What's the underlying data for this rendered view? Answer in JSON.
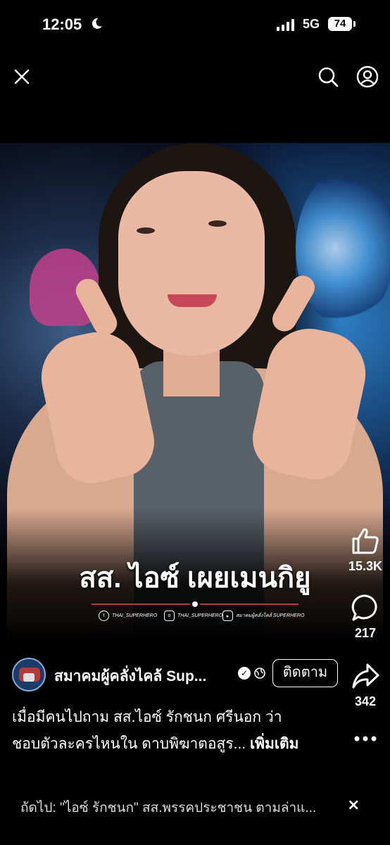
{
  "status_bar": {
    "time": "12:05",
    "network": "5G",
    "battery": "74"
  },
  "video": {
    "title_overlay": "สส. ไอซ์ เผยเมนกิยู",
    "social_handles": [
      "THAI_SUPERHERO",
      "THAI_SUPERHERO",
      "สมาคมผู้คลั่งไคล้ SUPERHERO"
    ]
  },
  "actions": {
    "likes": "15.3K",
    "comments": "217",
    "shares": "342"
  },
  "post": {
    "page_name": "สมาคมผู้คลั่งไคล้ Sup...",
    "follow_label": "ติดตาม",
    "description_line1": "เมื่อมีคนไปถาม สส.ไอซ์ รักชนก ศรีนอก ว่า",
    "description_line2": "ชอบตัวละครไหนใน ดาบพิฆาตอสูร...",
    "more_label": "เพิ่มเติม"
  },
  "next_up": {
    "text": "ถัดไป: \"ไอซ์ รักชนก\" สส.พรรคประชาชน ตามล่าแ...",
    "close": "×"
  },
  "icons": [
    "moon-icon",
    "signal-icon",
    "close-icon",
    "search-icon",
    "profile-icon",
    "like-icon",
    "comment-icon",
    "share-icon",
    "more-icon",
    "verified-icon",
    "globe-icon",
    "twitter-icon",
    "instagram-icon",
    "youtube-icon"
  ]
}
